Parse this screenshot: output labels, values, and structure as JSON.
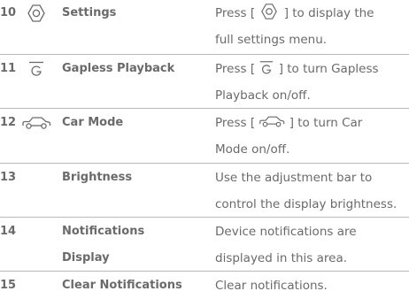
{
  "rows": [
    {
      "number": "10",
      "icon": "settings-icon",
      "name": "Settings",
      "desc_before_icon": "Press [",
      "desc_after_icon": "] to display the",
      "desc_line2": "full settings menu."
    },
    {
      "number": "11",
      "icon": "gapless-playback-icon",
      "name": "Gapless Playback",
      "desc_before_icon": "Press [",
      "desc_after_icon": "] to turn Gapless",
      "desc_line2": "Playback on/off."
    },
    {
      "number": "12",
      "icon": "car-mode-icon",
      "name": "Car Mode",
      "desc_before_icon": "Press [",
      "desc_after_icon": "] to turn Car",
      "desc_line2": "Mode on/off."
    },
    {
      "number": "13",
      "name": "Brightness",
      "desc_line1": "Use the adjustment bar to",
      "desc_line2": "control the display brightness."
    },
    {
      "number": "14",
      "name_line1": "Notifications",
      "name_line2": "Display",
      "desc_line1": "Device notifications are",
      "desc_line2": "displayed in this area."
    },
    {
      "number": "15",
      "name": "Clear Notifications",
      "desc_line1": "Clear notifications."
    }
  ],
  "colors": {
    "text": "#6a6a6a",
    "divider": "#b9b9b9"
  }
}
